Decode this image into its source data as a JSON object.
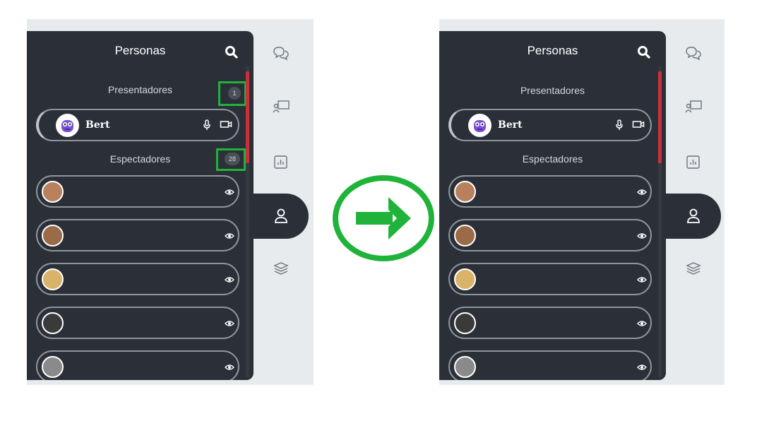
{
  "before": {
    "panel": {
      "title": "Personas",
      "presenters": {
        "title": "Presentadores",
        "count": "1"
      },
      "presenter": {
        "name": "Bert"
      },
      "viewers": {
        "title": "Espectadores",
        "count": "28"
      },
      "viewer_rows": 5
    },
    "tabs": [
      "chat-tab",
      "presentation-tab",
      "polls-tab",
      "people-tab",
      "layers-tab"
    ]
  },
  "after": {
    "panel": {
      "title": "Personas",
      "presenters": {
        "title": "Presentadores"
      },
      "presenter": {
        "name": "Bert"
      },
      "viewers": {
        "title": "Espectadores"
      },
      "viewer_rows": 5
    }
  },
  "colors": {
    "panel": "#2b3038",
    "sidebar": "#e8ebed",
    "scroll_thumb": "#c8313b",
    "highlight": "#1fb33a",
    "arrow": "#1fb33a"
  }
}
